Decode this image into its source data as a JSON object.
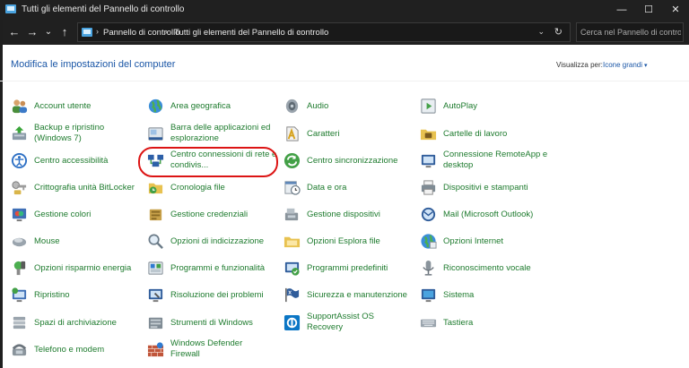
{
  "window": {
    "title": "Tutti gli elementi del Pannello di controllo",
    "minimize": "—",
    "maximize": "☐",
    "close": "✕"
  },
  "nav": {
    "back": "←",
    "forward": "→",
    "recent": "⌄",
    "up": "↑",
    "breadcrumbs": [
      "Pannello di controllo",
      "Tutti gli elementi del Pannello di controllo"
    ],
    "separator": "›",
    "dropdown": "⌄",
    "refresh": "↻",
    "search_placeholder": "Cerca nel Pannello di contro"
  },
  "header": {
    "title": "Modifica le impostazioni del computer",
    "view_by_label": "Visualizza per:",
    "view_by_value": "Icone grandi",
    "caret": "▾"
  },
  "items": {
    "col1": [
      {
        "label": "Account utente",
        "icon": "users-icon"
      },
      {
        "label": "Backup e ripristino (Windows 7)",
        "icon": "backup-icon"
      },
      {
        "label": "Centro accessibilità",
        "icon": "accessibility-icon"
      },
      {
        "label": "Crittografia unità BitLocker",
        "icon": "key-icon"
      },
      {
        "label": "Gestione colori",
        "icon": "color-icon"
      },
      {
        "label": "Mouse",
        "icon": "mouse-icon"
      },
      {
        "label": "Opzioni risparmio energia",
        "icon": "power-icon"
      },
      {
        "label": "Ripristino",
        "icon": "recovery-icon"
      },
      {
        "label": "Spazi di archiviazione",
        "icon": "storage-icon"
      },
      {
        "label": "Telefono e modem",
        "icon": "phone-icon"
      }
    ],
    "col2": [
      {
        "label": "Area geografica",
        "icon": "globe-icon"
      },
      {
        "label": "Barra delle applicazioni ed esplorazione",
        "icon": "taskbar-icon"
      },
      {
        "label": "Centro connessioni di rete e condivis...",
        "icon": "network-icon"
      },
      {
        "label": "Cronologia file",
        "icon": "file-history-icon"
      },
      {
        "label": "Gestione credenziali",
        "icon": "credentials-icon"
      },
      {
        "label": "Opzioni di indicizzazione",
        "icon": "indexing-icon"
      },
      {
        "label": "Programmi e funzionalità",
        "icon": "programs-icon"
      },
      {
        "label": "Risoluzione dei problemi",
        "icon": "troubleshoot-icon"
      },
      {
        "label": "Strumenti di Windows",
        "icon": "tools-icon"
      },
      {
        "label": "Windows Defender Firewall",
        "icon": "firewall-icon"
      }
    ],
    "col3": [
      {
        "label": "Audio",
        "icon": "speaker-icon"
      },
      {
        "label": "Caratteri",
        "icon": "fonts-icon"
      },
      {
        "label": "Centro sincronizzazione",
        "icon": "sync-icon"
      },
      {
        "label": "Data e ora",
        "icon": "clock-icon"
      },
      {
        "label": "Gestione dispositivi",
        "icon": "device-manager-icon"
      },
      {
        "label": "Opzioni Esplora file",
        "icon": "folder-options-icon"
      },
      {
        "label": "Programmi predefiniti",
        "icon": "default-programs-icon"
      },
      {
        "label": "Sicurezza e manutenzione",
        "icon": "flag-icon"
      },
      {
        "label": "SupportAssist OS Recovery",
        "icon": "supportassist-icon"
      }
    ],
    "col4": [
      {
        "label": "AutoPlay",
        "icon": "autoplay-icon"
      },
      {
        "label": "Cartelle di lavoro",
        "icon": "work-folders-icon"
      },
      {
        "label": "Connessione RemoteApp e desktop",
        "icon": "remoteapp-icon"
      },
      {
        "label": "Dispositivi e stampanti",
        "icon": "printer-icon"
      },
      {
        "label": "Mail (Microsoft Outlook)",
        "icon": "mail-icon"
      },
      {
        "label": "Opzioni Internet",
        "icon": "internet-icon"
      },
      {
        "label": "Riconoscimento vocale",
        "icon": "microphone-icon"
      },
      {
        "label": "Sistema",
        "icon": "system-icon"
      },
      {
        "label": "Tastiera",
        "icon": "keyboard-icon"
      }
    ]
  }
}
